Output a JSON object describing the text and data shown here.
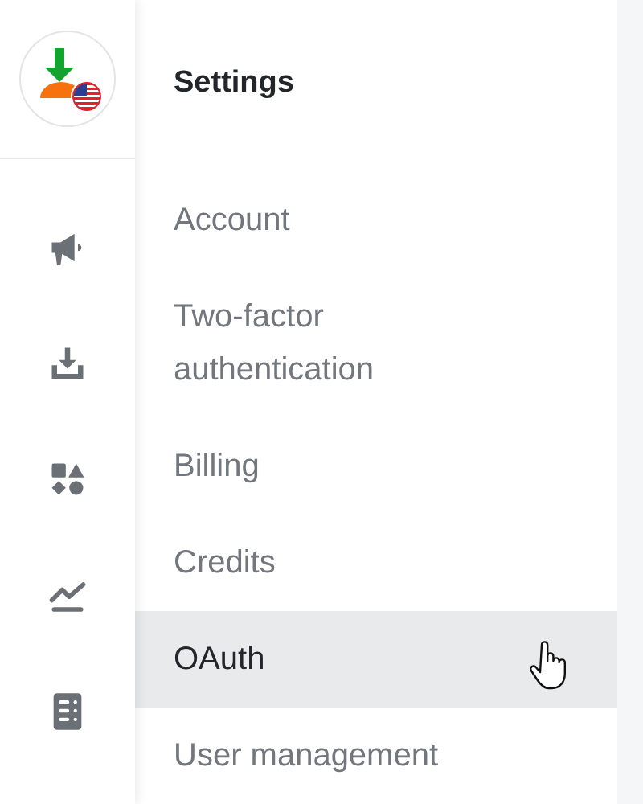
{
  "sidebar": {
    "items": [
      {
        "kind": "megaphone"
      },
      {
        "kind": "download"
      },
      {
        "kind": "shapes"
      },
      {
        "kind": "chart"
      },
      {
        "kind": "list"
      }
    ]
  },
  "settings": {
    "title": "Settings",
    "items": [
      {
        "label": "Account",
        "selected": false
      },
      {
        "label": "Two-factor authentication",
        "selected": false
      },
      {
        "label": "Billing",
        "selected": false
      },
      {
        "label": "Credits",
        "selected": false
      },
      {
        "label": "OAuth",
        "selected": true
      },
      {
        "label": "User management",
        "selected": false
      }
    ]
  }
}
